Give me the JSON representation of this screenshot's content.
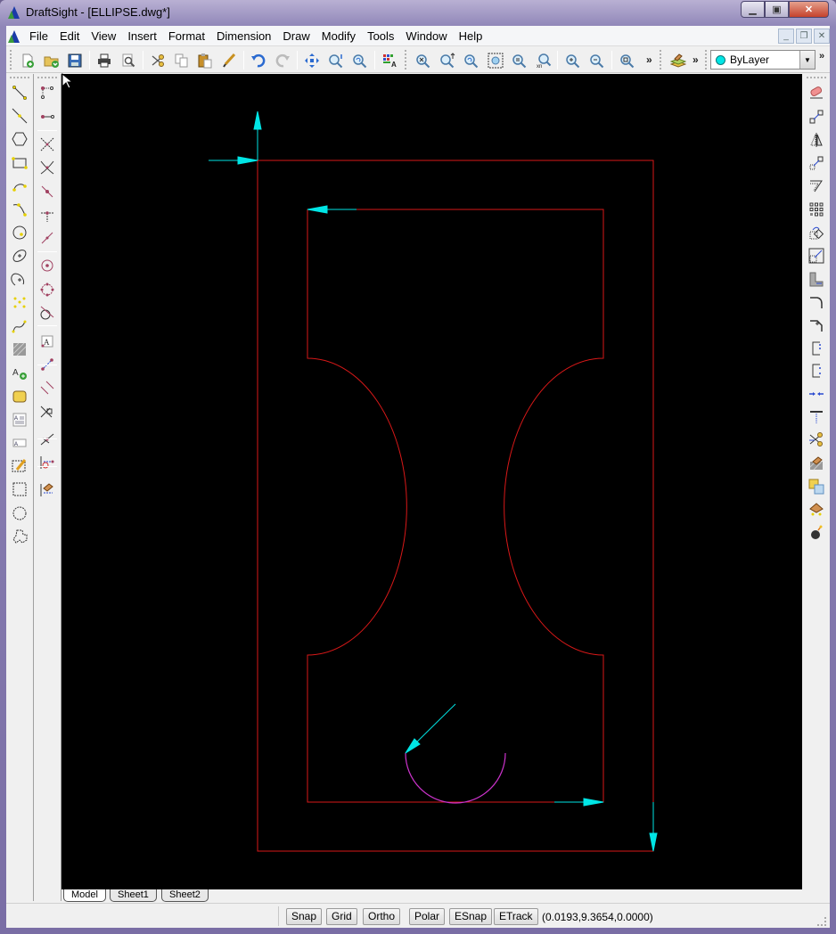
{
  "window": {
    "title": "DraftSight - [ELLIPSE.dwg*]",
    "controls": [
      "minimize",
      "maximize",
      "close"
    ]
  },
  "menubar": {
    "items": [
      "File",
      "Edit",
      "View",
      "Insert",
      "Format",
      "Dimension",
      "Draw",
      "Modify",
      "Tools",
      "Window",
      "Help"
    ],
    "mdi_controls": [
      "minimize",
      "restore",
      "close"
    ]
  },
  "toolbar": {
    "buttons": [
      "new-icon",
      "open-icon",
      "save-icon",
      "print-icon",
      "print-preview-icon",
      "cut-icon",
      "copy-icon",
      "paste-icon",
      "format-painter-icon",
      "undo-icon",
      "redo-icon",
      "pan-icon",
      "zoom-realtime-icon",
      "zoom-previous-icon",
      "layer-manager-icon",
      "zoom-fit-icon",
      "zoom-dynamic-icon",
      "zoom-previous2-icon",
      "zoom-window-icon",
      "zoom-bounds-icon",
      "zoom-factor-icon",
      "zoom-in-icon",
      "zoom-out-icon",
      "zoom-history-icon",
      "layer-state-icon"
    ],
    "overflow_label": "»",
    "layer_combo": {
      "value": "ByLayer",
      "color": "#00e5e5"
    }
  },
  "draw_toolbar": {
    "buttons": [
      "line-icon",
      "infinite-line-icon",
      "polygon-icon",
      "rectangle-icon",
      "arc-icon",
      "polyline-arc-icon",
      "circle-icon",
      "ellipse-icon",
      "ellipse-arc-icon",
      "point-icon",
      "spline-icon",
      "hatch-icon",
      "add-attribute-icon",
      "revision-cloud-icon",
      "multiline-text-icon",
      "simple-text-icon",
      "freehand-sketch-icon",
      "rectangular-boundary-icon",
      "circular-boundary-icon",
      "polygonal-boundary-icon"
    ]
  },
  "snap_toolbar": {
    "buttons": [
      "snap-endpoint-icon",
      "snap-midpoint-icon",
      "snap-intersection-icon",
      "snap-apparent-intersection-icon",
      "snap-nearest-icon",
      "snap-perpendicular-icon",
      "snap-extension-icon",
      "snap-center-icon",
      "snap-quadrant-icon",
      "snap-tangent-icon",
      "snap-insertion-icon",
      "snap-node-icon",
      "snap-parallel-icon",
      "snap-perpendicular2-icon",
      "snap-extension2-icon",
      "snap-clear-icon",
      "snap-settings-icon"
    ]
  },
  "modify_toolbar": {
    "buttons": [
      "erase-icon",
      "copy-entity-icon",
      "mirror-icon",
      "move-icon",
      "offset-icon",
      "pattern-icon",
      "rotate-icon",
      "scale-icon",
      "stretch-icon",
      "fillet-icon",
      "chamfer-icon",
      "lengthen-icon",
      "split-icon",
      "weld-icon",
      "extend-icon",
      "trim-icon",
      "hatch-edit-icon",
      "display-order-icon",
      "edit-block-icon",
      "explode-icon"
    ]
  },
  "drawing": {
    "outline_color": "#d81818",
    "dimension_color": "#00e5e5",
    "arc_color": "#cc33cc",
    "background": "#000000"
  },
  "sheet_tabs": [
    {
      "label": "Model",
      "active": true
    },
    {
      "label": "Sheet1",
      "active": false
    },
    {
      "label": "Sheet2",
      "active": false
    }
  ],
  "statusbar": {
    "toggles": [
      "Snap",
      "Grid",
      "Ortho",
      "Polar",
      "ESnap",
      "ETrack"
    ],
    "coordinates": "(0.0193,9.3654,0.0000)"
  }
}
